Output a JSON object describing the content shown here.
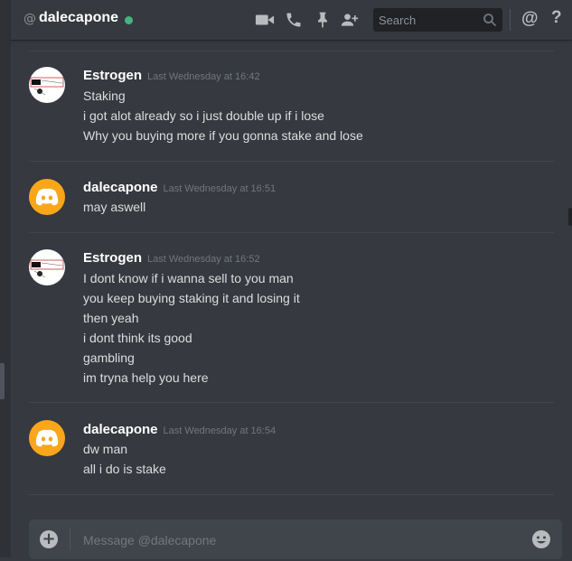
{
  "header": {
    "at_symbol": "@",
    "channel_name": "dalecapone",
    "status_color": "#43b581",
    "icons": [
      "video-call-icon",
      "voice-call-icon",
      "pin-icon",
      "add-friend-icon",
      "mention-icon",
      "help-icon"
    ],
    "search_placeholder": "Search",
    "mention_label": "@",
    "help_label": "?"
  },
  "messages": [
    {
      "author": "Estrogen",
      "timestamp": "Last Wednesday at 16:42",
      "lines": [
        "Staking",
        "i got alot already so i just double up if i lose",
        "Why you buying more if you gonna stake and lose"
      ]
    },
    {
      "author": "dalecapone",
      "timestamp": "Last Wednesday at 16:51",
      "lines": [
        "may aswell"
      ]
    },
    {
      "author": "Estrogen",
      "timestamp": "Last Wednesday at 16:52",
      "lines": [
        "I dont know if i wanna sell to you man",
        "you keep buying staking it and losing it",
        "then yeah",
        "i dont think its good",
        "gambling",
        "im tryna help you here"
      ]
    },
    {
      "author": "dalecapone",
      "timestamp": "Last Wednesday at 16:54",
      "lines": [
        "dw man",
        "all i do is stake"
      ]
    }
  ],
  "composer": {
    "placeholder": "Message @dalecapone",
    "add_label": "+"
  },
  "colors": {
    "background": "#36393f",
    "dale_avatar": "#faa61a",
    "online": "#43b581"
  }
}
